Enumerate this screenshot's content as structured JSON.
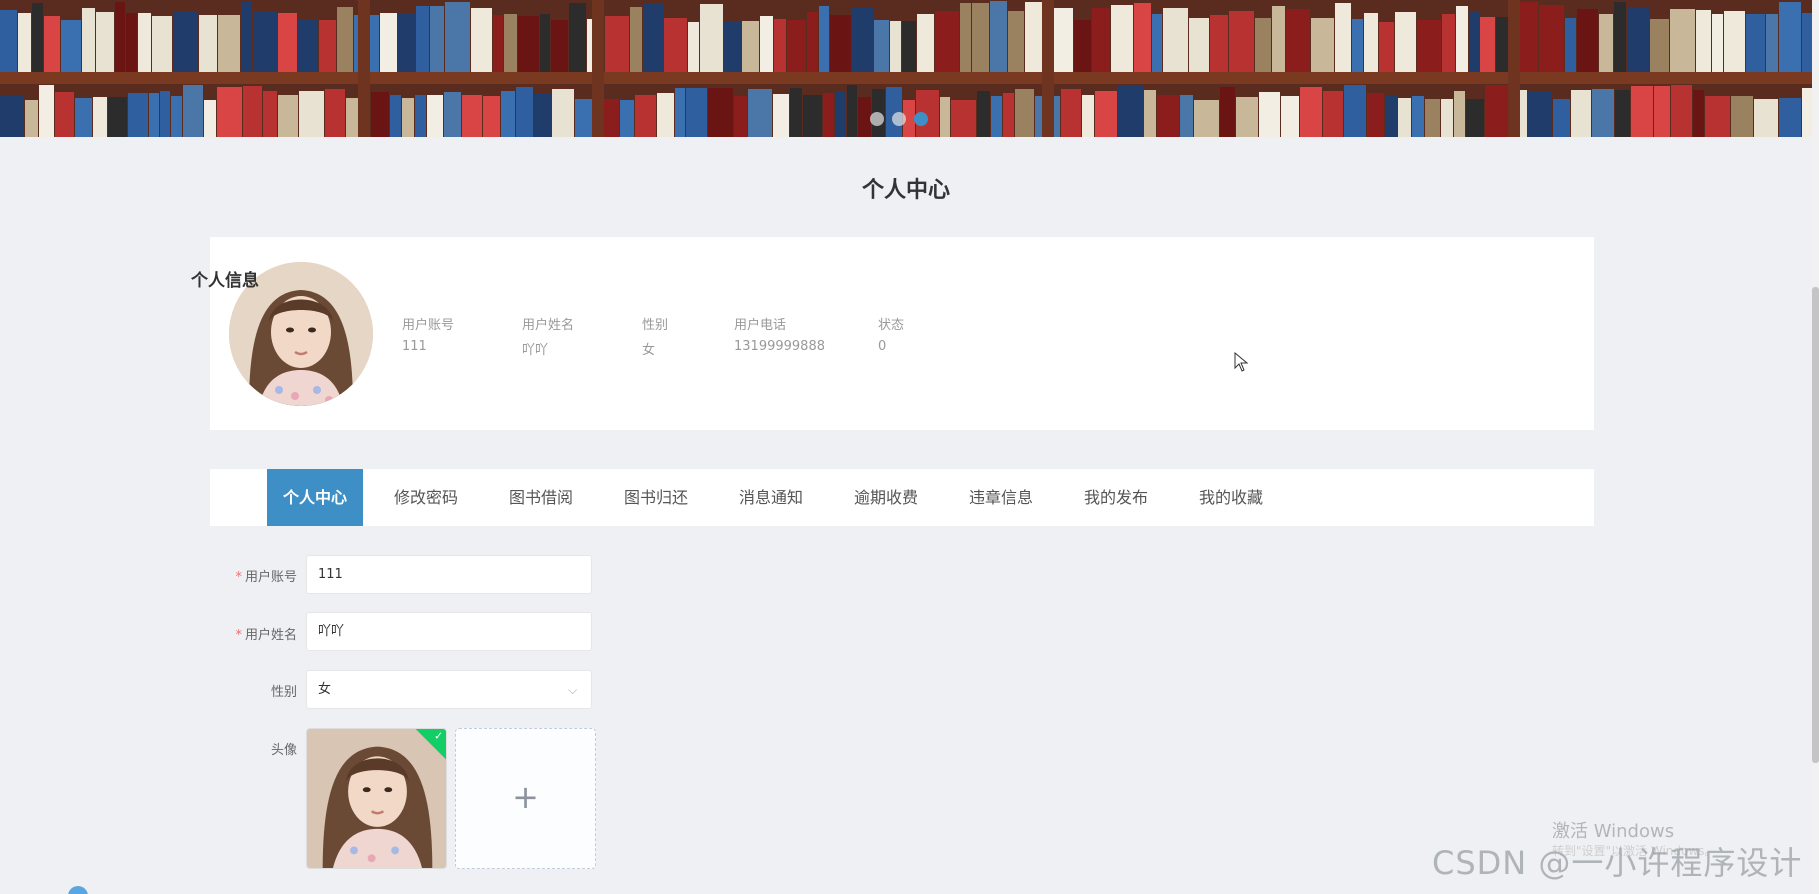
{
  "banner": {
    "dots": 3,
    "active_dot": 2
  },
  "page_title": "个人中心",
  "profile": {
    "heading": "个人信息",
    "fields": [
      {
        "label": "用户账号",
        "value": "111"
      },
      {
        "label": "用户姓名",
        "value": "吖吖"
      },
      {
        "label": "性别",
        "value": "女"
      },
      {
        "label": "用户电话",
        "value": "13199999888"
      },
      {
        "label": "状态",
        "value": "0"
      }
    ]
  },
  "tabs": [
    {
      "label": "个人中心",
      "active": true
    },
    {
      "label": "修改密码",
      "active": false
    },
    {
      "label": "图书借阅",
      "active": false
    },
    {
      "label": "图书归还",
      "active": false
    },
    {
      "label": "消息通知",
      "active": false
    },
    {
      "label": "逾期收费",
      "active": false
    },
    {
      "label": "违章信息",
      "active": false
    },
    {
      "label": "我的发布",
      "active": false
    },
    {
      "label": "我的收藏",
      "active": false
    }
  ],
  "form": {
    "account_label": "用户账号",
    "account_value": "111",
    "name_label": "用户姓名",
    "name_value": "吖吖",
    "gender_label": "性别",
    "gender_value": "女",
    "avatar_label": "头像",
    "required_mark": "*"
  },
  "watermarks": {
    "activate_windows": "激活 Windows",
    "activate_sub": "转到\"设置\"以激活 Windows。",
    "csdn": "CSDN @一小许程序设计"
  },
  "colors": {
    "accent": "#3d8fc6",
    "success": "#13ce66",
    "required": "#f56c6c"
  }
}
